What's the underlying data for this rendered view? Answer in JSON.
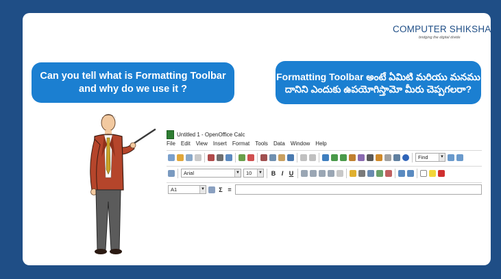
{
  "logo": {
    "text": "COMPUTER SHIKSHA",
    "tagline": "bridging the digital divide",
    "accent": "#e8731c",
    "brand": "#1f4e86"
  },
  "questions": {
    "english": "Can you tell what is Formatting Toolbar and why do we use it ?",
    "telugu": "Formatting Toolbar అంటే ఏమిటి మరియు మనము దానిని ఎందుకు ఉపయోగిస్తామో మీరు చెప్పగలరా?"
  },
  "app": {
    "title": "Untitled 1 - OpenOffice Calc",
    "menu": [
      "File",
      "Edit",
      "View",
      "Insert",
      "Format",
      "Tools",
      "Data",
      "Window",
      "Help"
    ],
    "find_placeholder": "Find",
    "font_name": "Arial",
    "font_size": "10",
    "format_buttons": [
      "B",
      "I",
      "U"
    ],
    "cell_ref": "A1",
    "formula_symbols": [
      "Σ",
      "="
    ]
  },
  "colors": {
    "bubble": "#1b7fd1",
    "frame": "#1f4e86",
    "slide": "#ffffff"
  }
}
